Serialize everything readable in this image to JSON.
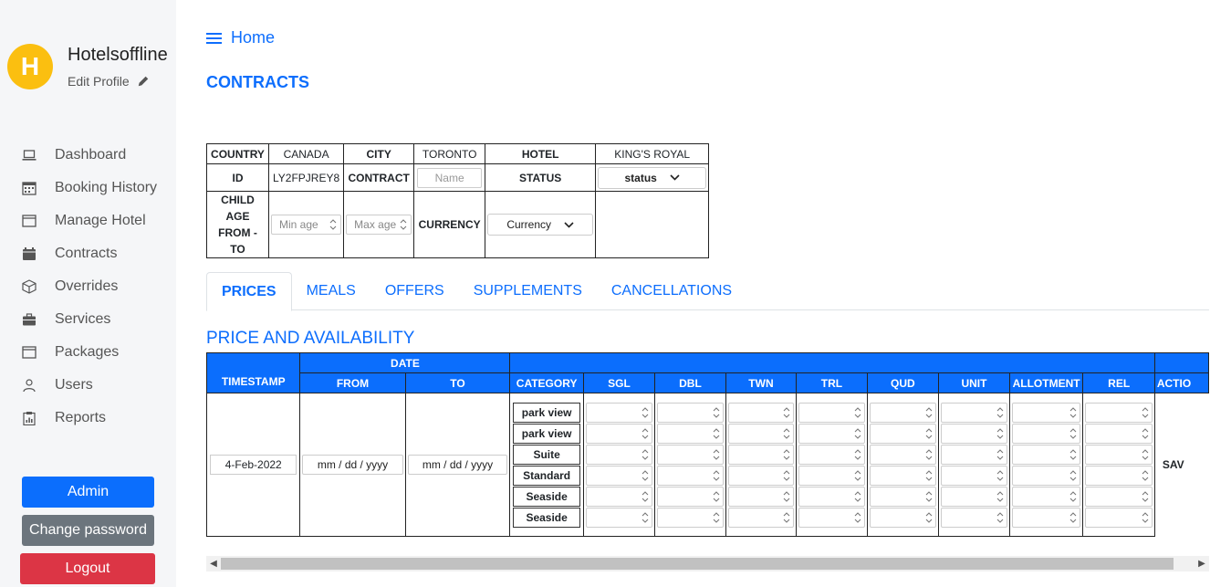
{
  "sidebar": {
    "avatar_letter": "H",
    "username": "Hotelsoffline",
    "edit_profile": "Edit Profile",
    "items": [
      {
        "label": "Dashboard",
        "icon": "laptop-icon"
      },
      {
        "label": "Booking History",
        "icon": "calendar-grid-icon"
      },
      {
        "label": "Manage Hotel",
        "icon": "window-icon"
      },
      {
        "label": "Contracts",
        "icon": "calendar-icon"
      },
      {
        "label": "Overrides",
        "icon": "box-icon"
      },
      {
        "label": "Services",
        "icon": "briefcase-icon"
      },
      {
        "label": "Packages",
        "icon": "window-icon"
      },
      {
        "label": "Users",
        "icon": "user-icon"
      },
      {
        "label": "Reports",
        "icon": "clipboard-icon"
      }
    ],
    "admin_label": "Admin",
    "change_password_label": "Change password",
    "logout_label": "Logout"
  },
  "header": {
    "home_label": "Home",
    "page_title": "CONTRACTS"
  },
  "info": {
    "country_label": "COUNTRY",
    "country_value": "CANADA",
    "city_label": "CITY",
    "city_value": "TORONTO",
    "hotel_label": "HOTEL",
    "hotel_value": "KING'S ROYAL",
    "id_label": "ID",
    "id_value": "LY2FPJREY8",
    "contract_label": "CONTRACT",
    "contract_placeholder": "Name",
    "status_label": "STATUS",
    "status_value": "status",
    "child_age_label_1": "CHILD AGE",
    "child_age_label_2": "FROM - TO",
    "min_age_placeholder": "Min age",
    "max_age_placeholder": "Max age",
    "currency_label": "CURRENCY",
    "currency_value": "Currency"
  },
  "tabs": [
    "PRICES",
    "MEALS",
    "OFFERS",
    "SUPPLEMENTS",
    "CANCELLATIONS"
  ],
  "section_title": "PRICE AND AVAILABILITY",
  "price_table": {
    "date_header": "DATE",
    "headers": {
      "timestamp": "TIMESTAMP",
      "from": "FROM",
      "to": "TO",
      "category": "CATEGORY",
      "sgl": "SGL",
      "dbl": "DBL",
      "twn": "TWN",
      "trl": "TRL",
      "qud": "QUD",
      "unit": "UNIT",
      "allotment": "ALLOTMENT",
      "rel": "REL",
      "action": "ACTIO"
    },
    "timestamp_value": "4-Feb-2022",
    "from_placeholder": "mm / dd / yyyy",
    "to_placeholder": "mm / dd / yyyy",
    "categories": [
      "park view",
      "park view",
      "Suite",
      "Standard",
      "Seaside",
      "Seaside"
    ],
    "save_label": "SAV"
  }
}
